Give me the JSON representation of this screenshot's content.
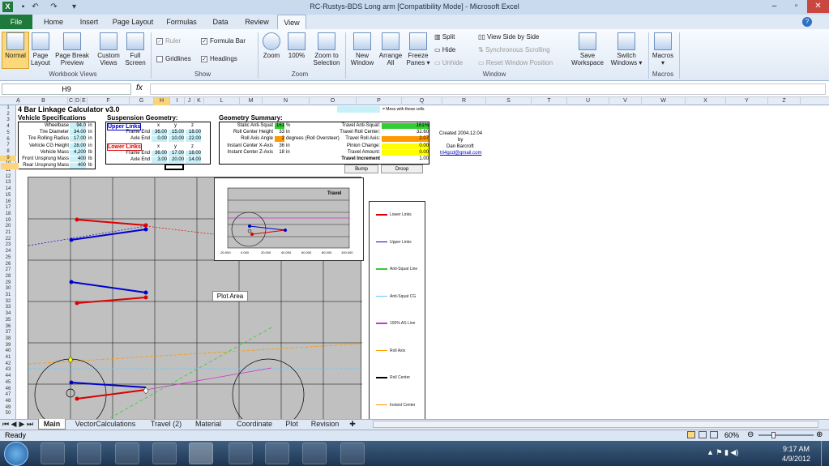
{
  "window": {
    "title": "RC-Rustys-BDS Long arm  [Compatibility Mode] - Microsoft Excel",
    "min": "–",
    "max": "▫",
    "close": "✕"
  },
  "tabs": [
    "File",
    "Home",
    "Insert",
    "Page Layout",
    "Formulas",
    "Data",
    "Review",
    "View"
  ],
  "ribbon": {
    "workbook_views": {
      "label": "Workbook Views",
      "normal": "Normal",
      "page_layout": "Page Layout",
      "page_break": "Page Break Preview",
      "custom": "Custom Views",
      "full": "Full Screen"
    },
    "show": {
      "label": "Show",
      "ruler": "Ruler",
      "formula_bar": "Formula Bar",
      "gridlines": "Gridlines",
      "headings": "Headings"
    },
    "zoom": {
      "label": "Zoom",
      "zoom": "Zoom",
      "hundred": "100%",
      "selection": "Zoom to Selection"
    },
    "window": {
      "label": "Window",
      "new": "New Window",
      "arrange": "Arrange All",
      "freeze": "Freeze Panes ▾",
      "split": "Split",
      "hide": "Hide",
      "unhide": "Unhide",
      "side": "View Side by Side",
      "sync": "Synchronous Scrolling",
      "reset": "Reset Window Position",
      "save_ws": "Save Workspace",
      "switch": "Switch Windows ▾"
    },
    "macros": {
      "label": "Macros",
      "macros": "Macros ▾"
    }
  },
  "formula": {
    "cell": "H9",
    "fx": "fx",
    "value": ""
  },
  "columns": [
    "A",
    "B",
    "C",
    "D",
    "E",
    "F",
    "G",
    "H",
    "I",
    "J",
    "K",
    "L",
    "M",
    "N",
    "O",
    "P",
    "Q",
    "R",
    "S",
    "T",
    "U",
    "V",
    "W",
    "X",
    "Y",
    "Z"
  ],
  "rows": [
    "1",
    "2",
    "3",
    "4",
    "5",
    "6",
    "7",
    "8",
    "9",
    "10",
    "11",
    "12",
    "13",
    "14",
    "15",
    "16",
    "17",
    "18",
    "19",
    "20",
    "21",
    "22",
    "23",
    "24",
    "25",
    "26",
    "27",
    "28",
    "29",
    "30",
    "31",
    "32",
    "33",
    "34",
    "35",
    "36",
    "37",
    "38",
    "39",
    "40",
    "41",
    "42",
    "43",
    "44",
    "45",
    "46",
    "47",
    "48",
    "49",
    "50"
  ],
  "sheet": {
    "title": "4 Bar Linkage Calculator v3.0",
    "note": "= Mess with these cells",
    "vehicle": {
      "header": "Vehicle Specifications",
      "rows": [
        {
          "l": "Wheelbase",
          "v": "94.0",
          "u": "in"
        },
        {
          "l": "Tire Diameter",
          "v": "34.00",
          "u": "in"
        },
        {
          "l": "Tire Rolling Radius",
          "v": "17.00",
          "u": "in"
        },
        {
          "l": "Vehicle CG Height",
          "v": "28.00",
          "u": "in"
        },
        {
          "l": "Vehicle Mass",
          "v": "4,200",
          "u": "lb"
        },
        {
          "l": "Front Unsprung Mass",
          "v": "400",
          "u": "lb"
        },
        {
          "l": "Rear Unsprung Mass",
          "v": "400",
          "u": "lb"
        }
      ]
    },
    "suspension": {
      "header": "Suspension Geometry:",
      "upper": "Upper Links",
      "lower": "Lower Links",
      "x": "x",
      "y": "y",
      "z": "z",
      "rows": [
        {
          "l": "Frame End",
          "x": "36.00",
          "y": "15.00",
          "z": "18.00"
        },
        {
          "l": "Axle End",
          "x": "0.00",
          "y": "10.00",
          "z": "22.00"
        },
        {
          "l": "Frame End",
          "x": "36.00",
          "y": "17.00",
          "z": "18.00"
        },
        {
          "l": "Axle End",
          "x": "3.00",
          "y": "20.00",
          "z": "14.00"
        }
      ]
    },
    "geometry": {
      "header": "Geometry Summary:",
      "rows": [
        {
          "l": "Static Anti-Squat",
          "v": "161",
          "u": "%"
        },
        {
          "l": "Roll Center Height",
          "v": "33",
          "u": "in"
        },
        {
          "l": "Roll Axis Angle",
          "v": "2",
          "u": "degrees (Roll Oversteer)"
        },
        {
          "l": "Instant Center X-Axis",
          "v": "36",
          "u": "in"
        },
        {
          "l": "Instant Center Z-Axis",
          "v": "18",
          "u": "in"
        }
      ]
    },
    "travel": {
      "rows": [
        {
          "l": "Travel Anti-Squat:",
          "v": "161%"
        },
        {
          "l": "Travel Roll Center:",
          "v": "32.60"
        },
        {
          "l": "Travel Roll Axis:",
          "v": "2.07"
        },
        {
          "l": "Pinion Change:",
          "v": "0.00"
        },
        {
          "l": "Travel Amount:",
          "v": "0.00"
        },
        {
          "l": "Travel Increment",
          "v": "1.00"
        }
      ]
    },
    "created": "Created 2004.12.04",
    "by": "by",
    "author": "Dan Barcroft",
    "email": "tri4gcd@gmail.com",
    "bump": "Bump",
    "droop": "Droop"
  },
  "chart": {
    "inset_title": "Travel",
    "inset_ticks": [
      "-20.000",
      "0.000",
      "20.000",
      "40.000",
      "60.000",
      "80.000",
      "100.000"
    ],
    "legend": [
      "Lower Links",
      "Upper Links",
      "Anti-Squat Line",
      "Anti-Squat CG",
      "100% AS Line",
      "Roll Axis",
      "Roll Center",
      "Instant Center"
    ],
    "tooltip": "Plot Area"
  },
  "sheets": [
    "Main",
    "VectorCalculations",
    "Travel (2)",
    "Material",
    "Coordinate",
    "Plot",
    "Revision"
  ],
  "status": {
    "left": "Ready",
    "zoom": "60%"
  },
  "clock": {
    "time": "9:17 AM",
    "date": "4/9/2012"
  },
  "colors": {
    "accent": "#1e7a3a",
    "upper": "#0000cc",
    "lower": "#dd0000",
    "green": "#33cc33",
    "orange": "#ff9900",
    "yellow": "#ffff00",
    "input": "#c8f0f8"
  }
}
